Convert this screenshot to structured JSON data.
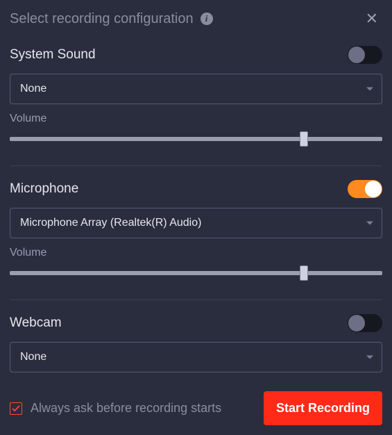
{
  "header": {
    "title": "Select recording configuration"
  },
  "systemSound": {
    "label": "System Sound",
    "enabled": false,
    "device": "None",
    "volumeLabel": "Volume",
    "volume": 79
  },
  "microphone": {
    "label": "Microphone",
    "enabled": true,
    "device": "Microphone Array (Realtek(R) Audio)",
    "volumeLabel": "Volume",
    "volume": 79
  },
  "webcam": {
    "label": "Webcam",
    "enabled": false,
    "device": "None"
  },
  "footer": {
    "askLabel": "Always ask before recording starts",
    "askChecked": true,
    "startLabel": "Start Recording"
  },
  "colors": {
    "accent": "#ff8a1f",
    "primary": "#ff2a17",
    "bg": "#2a2d3e"
  }
}
